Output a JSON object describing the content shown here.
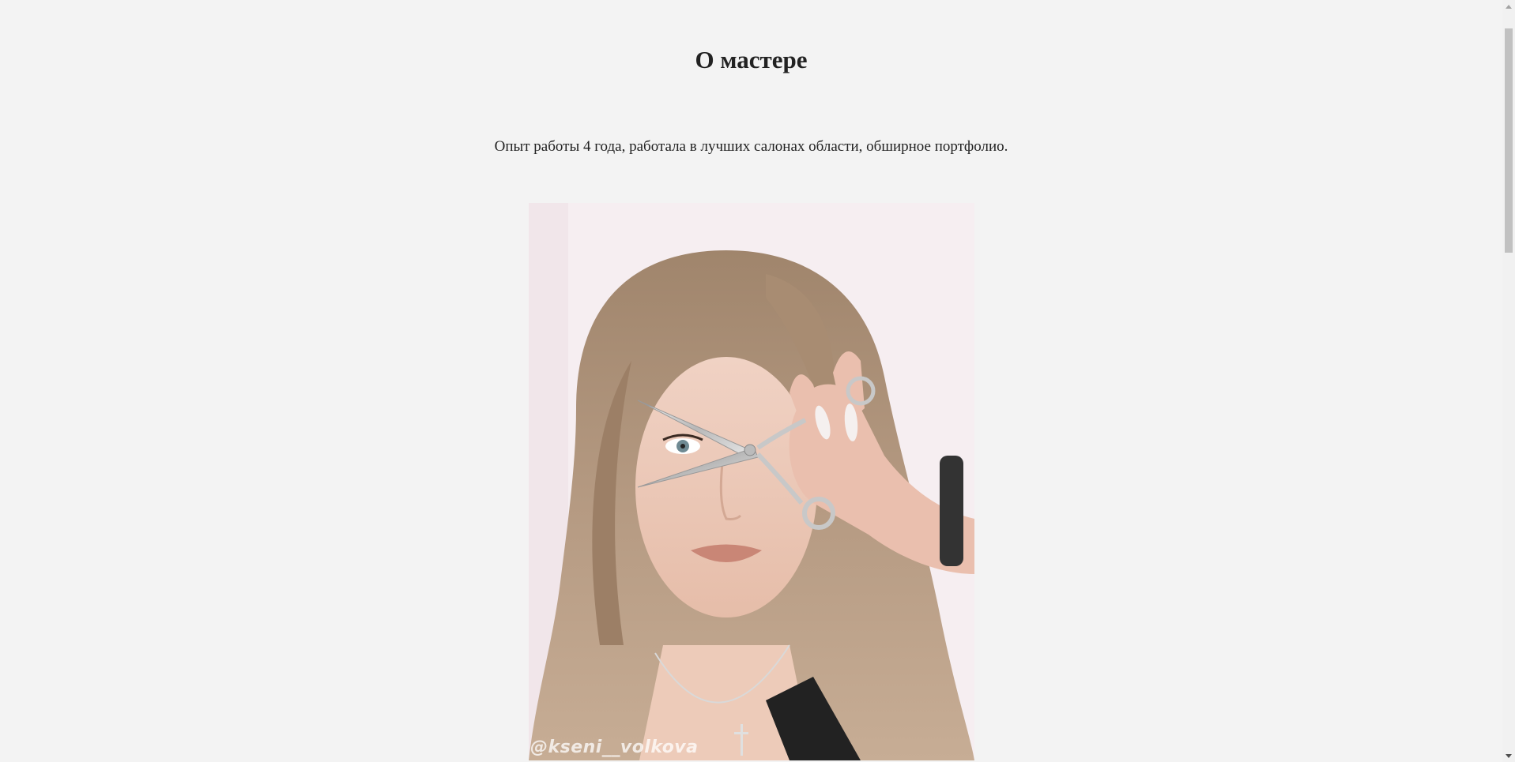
{
  "section": {
    "title": "О мастере",
    "description": "Опыт работы 4 года, работала в лучших салонах области, обширное портфолио."
  },
  "photo": {
    "watermark": "@kseni__volkova"
  },
  "colors": {
    "background": "#f3f3f3",
    "text": "#222222",
    "scrollbar_track": "#f1f1f1",
    "scrollbar_thumb": "#c1c1c1"
  }
}
